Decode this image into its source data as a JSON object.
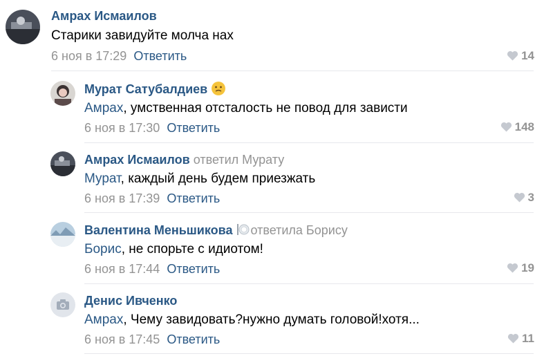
{
  "comments": [
    {
      "author": "Амрах Исмаилов",
      "reply_note": "",
      "mention": "",
      "text": "Старики завидуйте молча нах",
      "date": "6 ноя в 17:29",
      "reply_label": "Ответить",
      "likes": "14",
      "avatar_icon": "user-photo"
    },
    {
      "author": "Мурат Сатубалдиев",
      "reply_note": "",
      "mention": "Амрах",
      "text": ", умственная отсталость не повод для зависти",
      "date": "6 ноя в 17:30",
      "reply_label": "Ответить",
      "likes": "148",
      "avatar_icon": "user-photo",
      "emoji": "face-emoji"
    },
    {
      "author": "Амрах Исмаилов",
      "reply_note": "ответил Мурату",
      "mention": "Мурат",
      "text": ", каждый день будем приезжать",
      "date": "6 ноя в 17:39",
      "reply_label": "Ответить",
      "likes": "3",
      "avatar_icon": "user-photo"
    },
    {
      "author": "Валентина Меньшикова",
      "reply_note": "ответила Борису",
      "mention": "Борис",
      "text": ", не спорьте с идиотом!",
      "date": "6 ноя в 17:44",
      "reply_label": "Ответить",
      "likes": "19",
      "avatar_icon": "user-photo",
      "emoji": "plate-emoji"
    },
    {
      "author": "Денис Ивченко",
      "reply_note": "",
      "mention": "Амрах",
      "text": ", Чему завидовать?нужно думать головой!хотя...",
      "date": "6 ноя в 17:45",
      "reply_label": "Ответить",
      "likes": "11",
      "avatar_icon": "camera-icon"
    }
  ],
  "colors": {
    "link": "#2a5885",
    "muted": "#939393",
    "divider": "#e7e8ec"
  }
}
